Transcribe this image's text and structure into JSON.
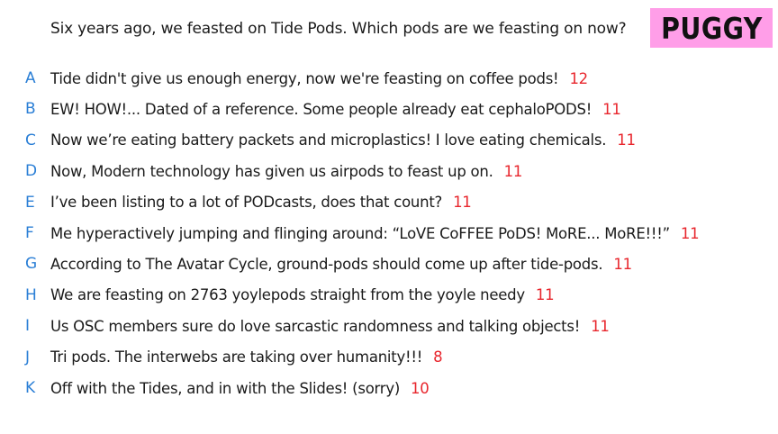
{
  "question": "Six years ago, we feasted on Tide Pods. Which pods are we feasting on now?",
  "badge": "PUGGY",
  "colors": {
    "letter": "#2b7fd6",
    "count": "#e8262d",
    "badge_bg": "#ff9ee8"
  },
  "options": [
    {
      "letter": "A",
      "text": "Tide didn't give us enough energy, now we're feasting on coffee pods!",
      "count": "12"
    },
    {
      "letter": "B",
      "text": "EW! HOW!... Dated of a reference. Some people already eat cephaloPODS!",
      "count": "11"
    },
    {
      "letter": "C",
      "text": "Now we’re eating battery packets and microplastics! I love eating chemicals.",
      "count": "11"
    },
    {
      "letter": "D",
      "text": "Now, Modern technology has given us airpods to feast up on.",
      "count": "11"
    },
    {
      "letter": "E",
      "text": "I’ve been listing to a lot of PODcasts, does that count?",
      "count": "11"
    },
    {
      "letter": "F",
      "text": "Me hyperactively jumping and flinging around: “LoVE CoFFEE PoDS! MoRE... MoRE!!!”",
      "count": "11"
    },
    {
      "letter": "G",
      "text": "According to The Avatar Cycle, ground-pods should come up after tide-pods.",
      "count": "11"
    },
    {
      "letter": "H",
      "text": "We are feasting on 2763 yoylepods straight from the yoyle needy",
      "count": "11"
    },
    {
      "letter": "I",
      "text": "Us OSC members sure do love sarcastic randomness and talking objects!",
      "count": "11"
    },
    {
      "letter": "J",
      "text": "Tri pods. The interwebs are taking over humanity!!!",
      "count": "8"
    },
    {
      "letter": "K",
      "text": "Off with the Tides, and in with the Slides! (sorry)",
      "count": "10"
    }
  ]
}
